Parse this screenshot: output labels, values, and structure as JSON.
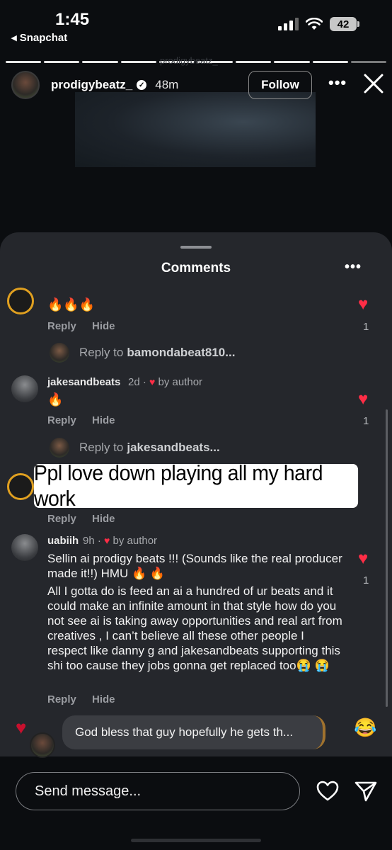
{
  "status_bar": {
    "time": "1:45",
    "back_app": "◂ Snapchat",
    "battery": "42"
  },
  "story": {
    "watermark": "prodigybeatz_",
    "username": "prodigybeatz_",
    "time_ago": "48m",
    "follow_label": "Follow",
    "more_label": "•••"
  },
  "comments_sheet": {
    "title": "Comments",
    "more_label": "•••",
    "comments": [
      {
        "text": "🔥🔥🔥",
        "reply_label": "Reply",
        "hide_label": "Hide",
        "likes": "1",
        "reply_prompt": "Reply to",
        "reply_to": "bamondabeat810..."
      },
      {
        "username": "jakesandbeats",
        "time": "2d ·",
        "author_tag": "by author",
        "text": "🔥",
        "reply_label": "Reply",
        "hide_label": "Hide",
        "likes": "1",
        "reply_prompt": "Reply to",
        "reply_to": "jakesandbeats..."
      },
      {
        "reply_label": "Reply",
        "hide_label": "Hide"
      },
      {
        "username": "uabiih",
        "time": "9h ·",
        "author_tag": "by author",
        "text_line1": "Sellin ai prodigy beats !!! (Sounds like the real producer made it!!) HMU 🔥 🔥",
        "text_body": "All I gotta do is feed an ai a hundred of ur beats and it could make an infinite amount in that style how do you not see ai is taking away opportunities and real art from creatives , I can’t believe all these other people I respect like danny g and jakesandbeats supporting this shi too cause they jobs gonna get replaced too😭 😭",
        "reply_label": "Reply",
        "hide_label": "Hide",
        "likes": "1"
      }
    ]
  },
  "caption_overlay": "Ppl love down playing all my hard work",
  "live_comment": "God bless that guy hopefully he gets th...",
  "composer": {
    "placeholder": "Send message..."
  },
  "colors": {
    "like_red": "#ff2d46",
    "sheet_bg": "#25272c",
    "ring_gold": "#e0a020"
  }
}
